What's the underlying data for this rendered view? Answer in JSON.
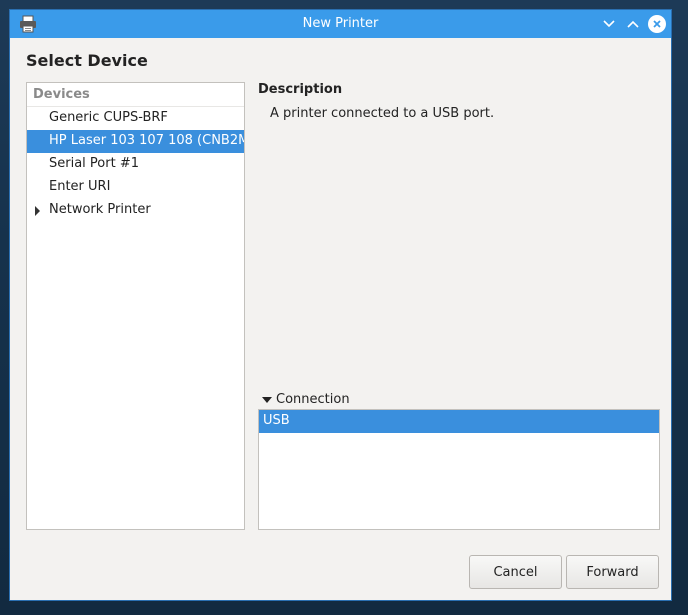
{
  "window": {
    "title": "New Printer",
    "icon": "printer-icon"
  },
  "titlebar_buttons": [
    "minimize-icon",
    "maximize-icon",
    "close-icon"
  ],
  "heading": "Select Device",
  "devices": {
    "header": "Devices",
    "items": [
      {
        "label": "Generic CUPS-BRF",
        "selected": false,
        "expandable": false
      },
      {
        "label": "HP Laser 103 107 108 (CNB2M",
        "selected": true,
        "expandable": false
      },
      {
        "label": "Serial Port #1",
        "selected": false,
        "expandable": false
      },
      {
        "label": "Enter URI",
        "selected": false,
        "expandable": false
      },
      {
        "label": "Network Printer",
        "selected": false,
        "expandable": true
      }
    ]
  },
  "description": {
    "label": "Description",
    "text": "A printer connected to a USB port."
  },
  "connection": {
    "label": "Connection",
    "items": [
      "USB"
    ]
  },
  "buttons": {
    "cancel": "Cancel",
    "forward": "Forward"
  },
  "colors": {
    "titlebar": "#3a9bea",
    "selection": "#3a8fdd",
    "window_bg": "#f3f2f0"
  }
}
